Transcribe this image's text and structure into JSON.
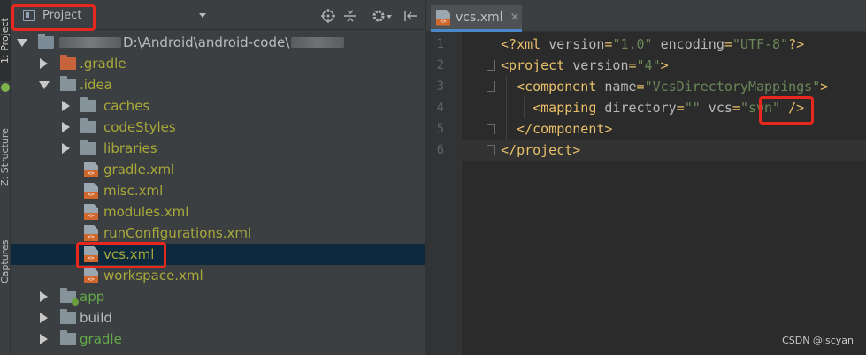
{
  "tool_window_tabs": {
    "project": "1: Project",
    "structure": "Z: Structure",
    "captures": "Captures"
  },
  "project_panel": {
    "title": "Project",
    "toolbar_icons": [
      "target-icon",
      "collapse-all-icon",
      "gear-icon",
      "hide-panel-icon"
    ],
    "tree": [
      {
        "label_prefix": "",
        "label": "D:\\Android\\android-code\\",
        "expanded": true,
        "kind": "module-folder",
        "color": "plain"
      },
      {
        "label": ".gradle",
        "expanded": false,
        "kind": "folder-orange",
        "color": "olive"
      },
      {
        "label": ".idea",
        "expanded": true,
        "kind": "folder",
        "color": "olive"
      },
      {
        "label": "caches",
        "expanded": false,
        "kind": "folder",
        "color": "olive"
      },
      {
        "label": "codeStyles",
        "expanded": false,
        "kind": "folder",
        "color": "olive"
      },
      {
        "label": "libraries",
        "expanded": false,
        "kind": "folder",
        "color": "olive"
      },
      {
        "label": "gradle.xml",
        "kind": "xml",
        "color": "olive"
      },
      {
        "label": "misc.xml",
        "kind": "xml",
        "color": "olive"
      },
      {
        "label": "modules.xml",
        "kind": "xml",
        "color": "olive"
      },
      {
        "label": "runConfigurations.xml",
        "kind": "xml",
        "color": "olive"
      },
      {
        "label": "vcs.xml",
        "kind": "xml",
        "color": "olive",
        "selected": true
      },
      {
        "label": "workspace.xml",
        "kind": "xml",
        "color": "olive"
      },
      {
        "label": "app",
        "expanded": false,
        "kind": "folder-green",
        "color": "green"
      },
      {
        "label": "build",
        "expanded": false,
        "kind": "folder",
        "color": "plain"
      },
      {
        "label": "gradle",
        "expanded": false,
        "kind": "folder",
        "color": "green"
      }
    ]
  },
  "editor": {
    "tab_label": "vcs.xml",
    "close_glyph": "×",
    "line_numbers": [
      "1",
      "2",
      "3",
      "4",
      "5",
      "6"
    ],
    "lines": [
      {
        "parts": [
          [
            "t-br",
            "<?"
          ],
          [
            "t-tag",
            "xml "
          ],
          [
            "t-attr",
            "version"
          ],
          [
            "t-br",
            "="
          ],
          [
            "t-val",
            "\"1.0\""
          ],
          [
            "t-attr",
            " encoding"
          ],
          [
            "t-br",
            "="
          ],
          [
            "t-val",
            "\"UTF-8\""
          ],
          [
            "t-br",
            "?>"
          ]
        ]
      },
      {
        "parts": [
          [
            "t-br",
            "<"
          ],
          [
            "t-tag",
            "project "
          ],
          [
            "t-attr",
            "version"
          ],
          [
            "t-br",
            "="
          ],
          [
            "t-val",
            "\"4\""
          ],
          [
            "t-br",
            ">"
          ]
        ]
      },
      {
        "parts": [
          [
            "t-br",
            "  <"
          ],
          [
            "t-tag",
            "component "
          ],
          [
            "t-attr",
            "name"
          ],
          [
            "t-br",
            "="
          ],
          [
            "t-val",
            "\"VcsDirectoryMappings\""
          ],
          [
            "t-br",
            ">"
          ]
        ]
      },
      {
        "parts": [
          [
            "t-br",
            "    <"
          ],
          [
            "t-tag",
            "mapping "
          ],
          [
            "t-attr",
            "directory"
          ],
          [
            "t-br",
            "="
          ],
          [
            "t-val",
            "\"\""
          ],
          [
            "t-attr",
            " vcs"
          ],
          [
            "t-br",
            "="
          ],
          [
            "t-val",
            "\"svn\""
          ],
          [
            "t-br",
            " />"
          ]
        ]
      },
      {
        "parts": [
          [
            "t-br",
            "  </"
          ],
          [
            "t-tag",
            "component"
          ],
          [
            "t-br",
            ">"
          ]
        ]
      },
      {
        "parts": [
          [
            "t-br",
            "</"
          ],
          [
            "t-tag",
            "project"
          ],
          [
            "t-br",
            ">"
          ]
        ]
      }
    ]
  },
  "watermark": "CSDN @iscyan"
}
